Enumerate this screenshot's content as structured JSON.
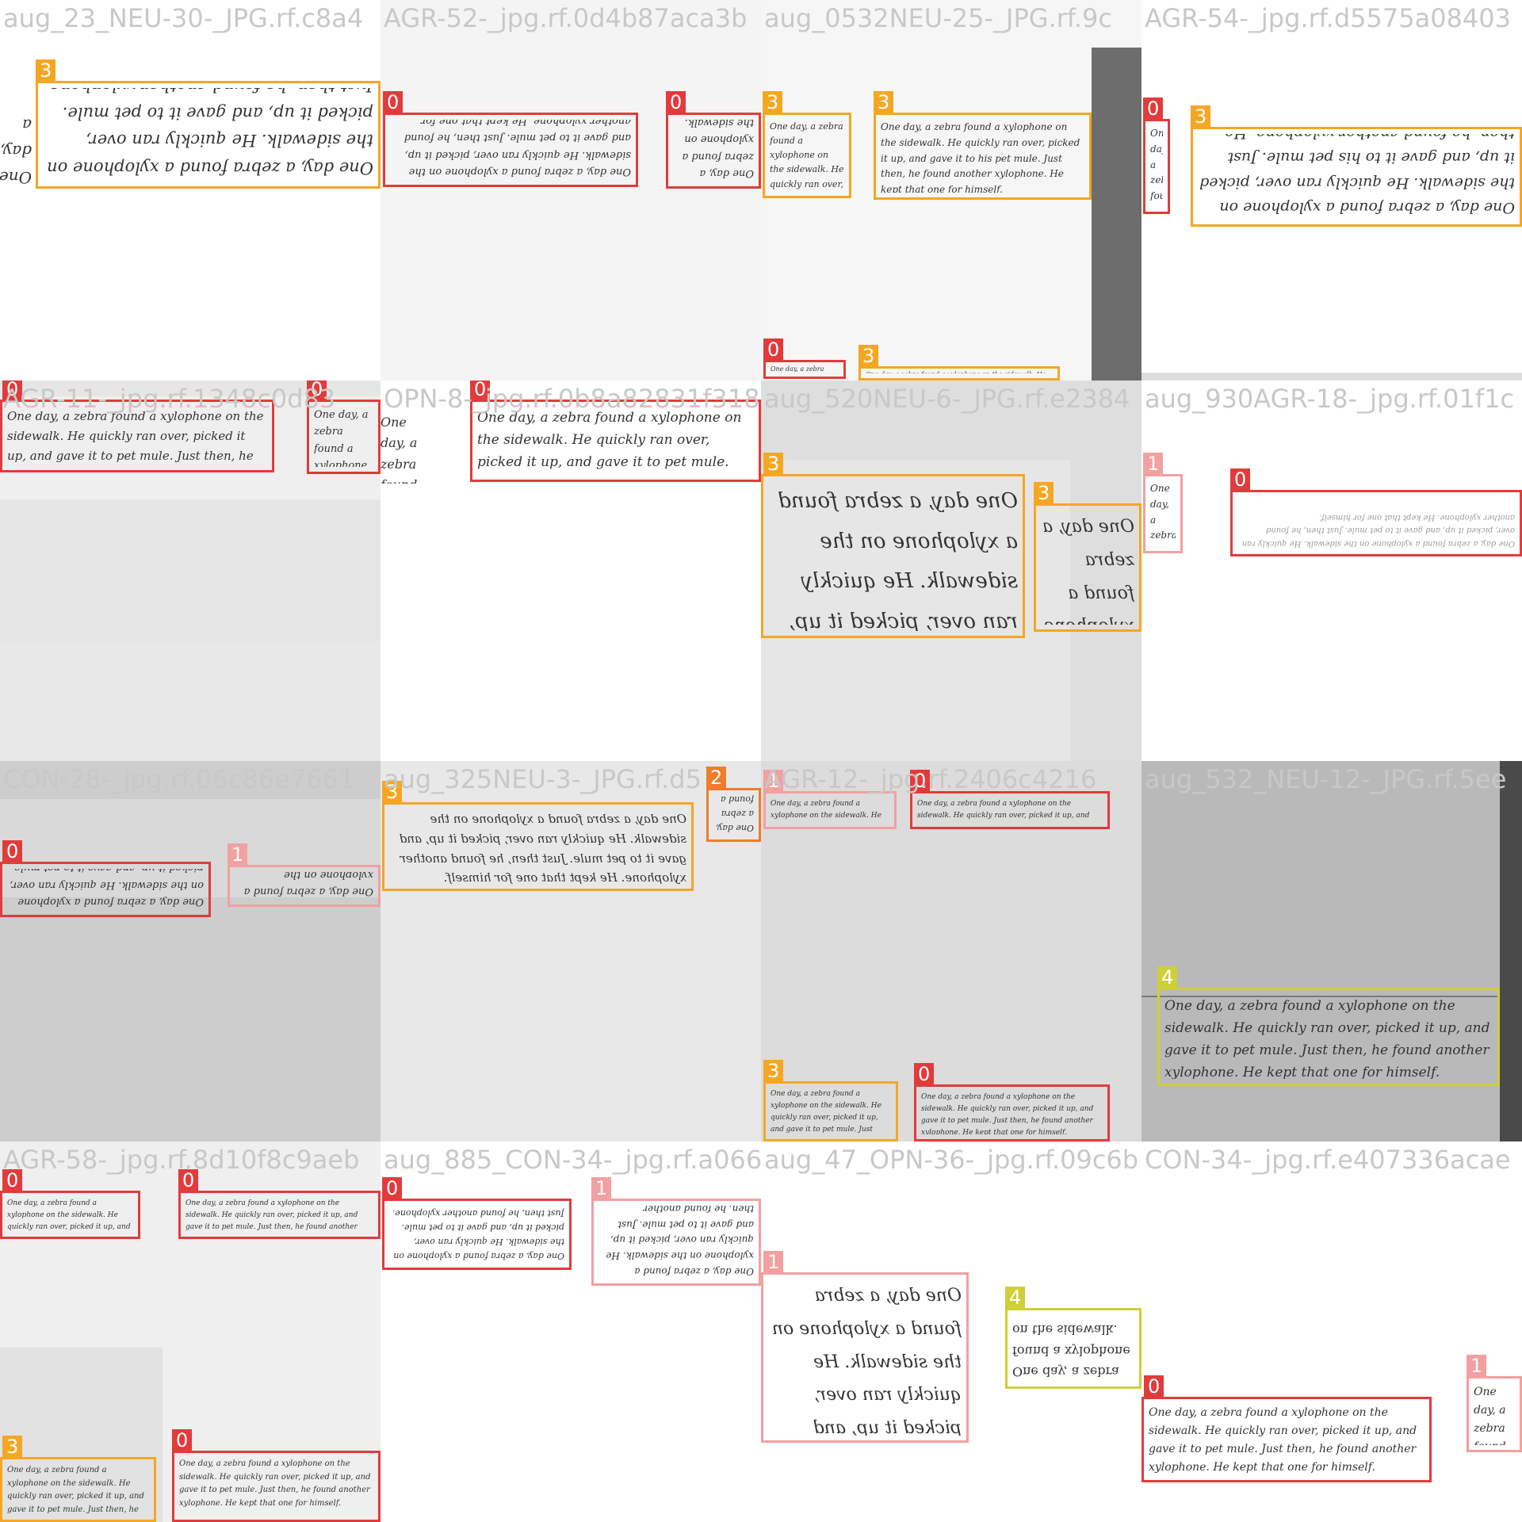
{
  "mosaic": {
    "size": "1920x1920",
    "grid": "4x4"
  },
  "classes": {
    "0": {
      "label": "0",
      "color": "#e23b3b"
    },
    "1": {
      "label": "1",
      "color": "#f2a0a0"
    },
    "2": {
      "label": "2",
      "color": "#f07c2c"
    },
    "3": {
      "label": "3",
      "color": "#f5a623"
    },
    "4": {
      "label": "4",
      "color": "#cfcf3a"
    }
  },
  "handwriting": {
    "full": "One day, a zebra found a xylophone on the sidewalk. He quickly ran over, picked it up, and gave it to pet mule. Just then, he found another xylophone. He kept that one for himself.",
    "b": "One day, a zebra found a xylophone on the sidewalk. He quickly ran over, picked it up, and gave it to pet mule. Just then, he found another xylophone. He kept that one for himself.",
    "c": "One day, a zebra found a xylophone on the sidewalk. He quickly ran over, picked it up, and gave it to his pet mule. Just then, he found another xylophone. He kept that one for himself.",
    "d": "One day, a zebra found a xylophone on the sidewalk. He quickly ran over, picked it up, and gave it to his pet mule. Just then, he found another xylophone. He kept that one for himself.",
    "e": "One day, a zebra found a xylophone on the sidewalk. He quickly ran over, picked it up, and gave it to pet mule. Just then, he found another xylophone. He kept that one for himself.",
    "f": "One day, a zebra found a xylophone on the sidewalk. He quickly ran over, picked it up, and gave it to pet mule. Just then, he found another xylophone. He kept that one for himself.",
    "g": "One day, a zebra found a xylophone on the sidewalk. He quickly ran over, picked it up, and gave it to pet mule. Just then, he found another xylophone. He kept that one for himself.",
    "h": "One day, a zebra found a xylophone on the sidewalk. He quickly ran over, picked it up, and gave it to pet mule. Just then, he found another xylophone. He kept that one for himself.",
    "i": "One day, a zebra found a xylophone on the sidewalk. He quickly ran over, picked it up, and gave it to pet mule. Just then, he found another xylophone. He kept that one for himself."
  },
  "tiles": [
    {
      "name": "aug_23_NEU-30-_JPG.rf.c8a4",
      "boxes": [
        {
          "cls": "3",
          "text": "full"
        }
      ]
    },
    {
      "name": "AGR-52-_jpg.rf.0d4b87aca3b",
      "boxes": [
        {
          "cls": "0",
          "text": "full"
        },
        {
          "cls": "0",
          "text": "full"
        }
      ]
    },
    {
      "name": "aug_0532NEU-25-_JPG.rf.9c",
      "boxes": [
        {
          "cls": "3",
          "text": "full"
        },
        {
          "cls": "3",
          "text": "full"
        },
        {
          "cls": "0",
          "text": "full"
        },
        {
          "cls": "3",
          "text": "full"
        }
      ]
    },
    {
      "name": "AGR-54-_jpg.rf.d5575a08403",
      "boxes": [
        {
          "cls": "0",
          "text": "full"
        },
        {
          "cls": "3",
          "text": "full"
        }
      ]
    },
    {
      "name": "AGR-11-_jpg.rf.1348c0d83",
      "boxes": [
        {
          "cls": "0",
          "text": "full"
        },
        {
          "cls": "0",
          "text": "full"
        }
      ]
    },
    {
      "name": "OPN-8-_jpg.rf.0b8a82831f318",
      "boxes": [
        {
          "cls": "0",
          "text": "full"
        }
      ]
    },
    {
      "name": "aug_520NEU-6-_JPG.rf.e2384",
      "boxes": [
        {
          "cls": "3",
          "text": "full"
        },
        {
          "cls": "3",
          "text": "full"
        }
      ]
    },
    {
      "name": "aug_930AGR-18-_jpg.rf.01f1c",
      "boxes": [
        {
          "cls": "1",
          "text": "full"
        },
        {
          "cls": "0",
          "text": "full"
        }
      ]
    },
    {
      "name": "CON-28-_jpg.rf.06c86e7661",
      "boxes": [
        {
          "cls": "0",
          "text": "full"
        },
        {
          "cls": "1",
          "text": "full"
        }
      ]
    },
    {
      "name": "aug_325NEU-3-_JPG.rf.d5",
      "boxes": [
        {
          "cls": "3",
          "text": "full"
        },
        {
          "cls": "2",
          "text": "full"
        }
      ]
    },
    {
      "name": "AGR-12-_jpg.rf.2406c4216",
      "boxes": [
        {
          "cls": "1",
          "text": "full"
        },
        {
          "cls": "0",
          "text": "full"
        },
        {
          "cls": "3",
          "text": "full"
        },
        {
          "cls": "0",
          "text": "full"
        }
      ]
    },
    {
      "name": "aug_532_NEU-12-_JPG.rf.5ee",
      "boxes": [
        {
          "cls": "4",
          "text": "full"
        }
      ]
    },
    {
      "name": "AGR-58-_jpg.rf.8d10f8c9aeb",
      "boxes": [
        {
          "cls": "0",
          "text": "full"
        },
        {
          "cls": "0",
          "text": "full"
        },
        {
          "cls": "3",
          "text": "full"
        },
        {
          "cls": "0",
          "text": "full"
        }
      ]
    },
    {
      "name": "aug_885_CON-34-_jpg.rf.a0667",
      "boxes": [
        {
          "cls": "0",
          "text": "full"
        },
        {
          "cls": "1",
          "text": "full"
        }
      ]
    },
    {
      "name": "aug_47_OPN-36-_jpg.rf.09c6b",
      "boxes": [
        {
          "cls": "1",
          "text": "full"
        },
        {
          "cls": "4",
          "text": "full"
        }
      ]
    },
    {
      "name": "CON-34-_jpg.rf.e407336acae",
      "boxes": [
        {
          "cls": "0",
          "text": "full"
        },
        {
          "cls": "1",
          "text": "full"
        }
      ]
    }
  ]
}
